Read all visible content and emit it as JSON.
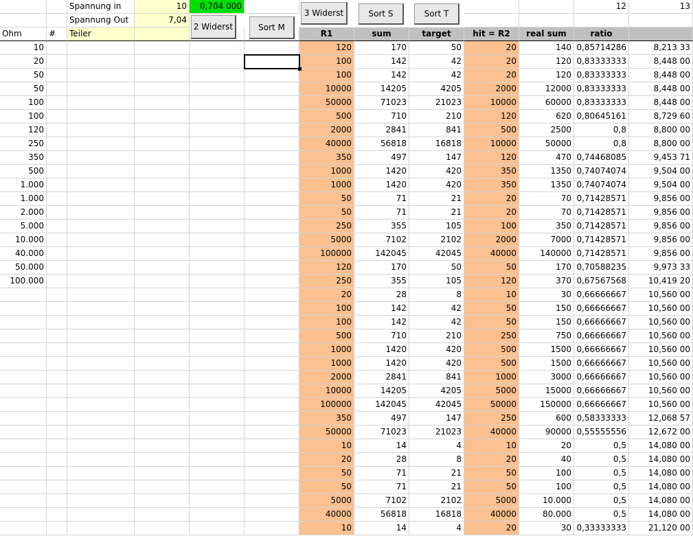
{
  "header": {
    "row0": {
      "label": "Spannung in",
      "value": "10",
      "result": "0,704 000",
      "col12": "12",
      "col13": "13"
    },
    "row1": {
      "label": "Spannung Out",
      "value": "7,04"
    },
    "row2": {
      "col_ohm": "Ohm",
      "col_hash": "#",
      "col_label": "Teiler"
    }
  },
  "buttons": {
    "three_widerst": "3 Widerst",
    "sort_s": "Sort S",
    "sort_t": "Sort T",
    "two_widerst": "2 Widerst",
    "sort_m": "Sort M"
  },
  "columns": [
    "R1",
    "sum",
    "target",
    "hit = R2",
    "real sum",
    "ratio"
  ],
  "ohm_values": [
    "10",
    "20",
    "50",
    "50",
    "100",
    "100",
    "120",
    "250",
    "350",
    "500",
    "1.000",
    "1.000",
    "2.000",
    "5.000",
    "10.000",
    "40.000",
    "50.000",
    "100.000"
  ],
  "rows": [
    [
      "120",
      "170",
      "50",
      "20",
      "140",
      "0,85714286",
      "8,213 33"
    ],
    [
      "100",
      "142",
      "42",
      "20",
      "120",
      "0,83333333",
      "8,448 00"
    ],
    [
      "100",
      "142",
      "42",
      "20",
      "120",
      "0,83333333",
      "8,448 00"
    ],
    [
      "10000",
      "14205",
      "4205",
      "2000",
      "12000",
      "0,83333333",
      "8,448 00"
    ],
    [
      "50000",
      "71023",
      "21023",
      "10000",
      "60000",
      "0,83333333",
      "8,448 00"
    ],
    [
      "500",
      "710",
      "210",
      "120",
      "620",
      "0,80645161",
      "8,729 60"
    ],
    [
      "2000",
      "2841",
      "841",
      "500",
      "2500",
      "0,8",
      "8,800 00"
    ],
    [
      "40000",
      "56818",
      "16818",
      "10000",
      "50000",
      "0,8",
      "8,800 00"
    ],
    [
      "350",
      "497",
      "147",
      "120",
      "470",
      "0,74468085",
      "9,453 71"
    ],
    [
      "1000",
      "1420",
      "420",
      "350",
      "1350",
      "0,74074074",
      "9,504 00"
    ],
    [
      "1000",
      "1420",
      "420",
      "350",
      "1350",
      "0,74074074",
      "9,504 00"
    ],
    [
      "50",
      "71",
      "21",
      "20",
      "70",
      "0,71428571",
      "9,856 00"
    ],
    [
      "50",
      "71",
      "21",
      "20",
      "70",
      "0,71428571",
      "9,856 00"
    ],
    [
      "250",
      "355",
      "105",
      "100",
      "350",
      "0,71428571",
      "9,856 00"
    ],
    [
      "5000",
      "7102",
      "2102",
      "2000",
      "7000",
      "0,71428571",
      "9,856 00"
    ],
    [
      "100000",
      "142045",
      "42045",
      "40000",
      "140000",
      "0,71428571",
      "9,856 00"
    ],
    [
      "120",
      "170",
      "50",
      "50",
      "170",
      "0,70588235",
      "9,973 33"
    ],
    [
      "250",
      "355",
      "105",
      "120",
      "370",
      "0,67567568",
      "10,419 20"
    ],
    [
      "20",
      "28",
      "8",
      "10",
      "30",
      "0,66666667",
      "10,560 00"
    ],
    [
      "100",
      "142",
      "42",
      "50",
      "150",
      "0,66666667",
      "10,560 00"
    ],
    [
      "100",
      "142",
      "42",
      "50",
      "150",
      "0,66666667",
      "10,560 00"
    ],
    [
      "500",
      "710",
      "210",
      "250",
      "750",
      "0,66666667",
      "10,560 00"
    ],
    [
      "1000",
      "1420",
      "420",
      "500",
      "1500",
      "0,66666667",
      "10,560 00"
    ],
    [
      "1000",
      "1420",
      "420",
      "500",
      "1500",
      "0,66666667",
      "10,560 00"
    ],
    [
      "2000",
      "2841",
      "841",
      "1000",
      "3000",
      "0,66666667",
      "10,560 00"
    ],
    [
      "10000",
      "14205",
      "4205",
      "5000",
      "15000",
      "0,66666667",
      "10,560 00"
    ],
    [
      "100000",
      "142045",
      "42045",
      "50000",
      "150000",
      "0,66666667",
      "10,560 00"
    ],
    [
      "350",
      "497",
      "147",
      "250",
      "600",
      "0,58333333",
      "12,068 57"
    ],
    [
      "50000",
      "71023",
      "21023",
      "40000",
      "90000",
      "0,55555556",
      "12,672 00"
    ],
    [
      "10",
      "14",
      "4",
      "10",
      "20",
      "0,5",
      "14,080 00"
    ],
    [
      "20",
      "28",
      "8",
      "20",
      "40",
      "0,5",
      "14,080 00"
    ],
    [
      "50",
      "71",
      "21",
      "50",
      "100",
      "0,5",
      "14,080 00"
    ],
    [
      "50",
      "71",
      "21",
      "50",
      "100",
      "0,5",
      "14,080 00"
    ],
    [
      "5000",
      "7102",
      "2102",
      "5000",
      "10.000",
      "0,5",
      "14,080 00"
    ],
    [
      "40000",
      "56818",
      "16818",
      "40000",
      "80.000",
      "0,5",
      "14,080 00"
    ],
    [
      "10",
      "14",
      "4",
      "20",
      "30",
      "0,33333333",
      "21,120 00"
    ]
  ],
  "colors": {
    "orange": "#fac090",
    "yellow": "#ffffcc",
    "green": "#00e000",
    "header_gray": "#c0c0c0"
  }
}
